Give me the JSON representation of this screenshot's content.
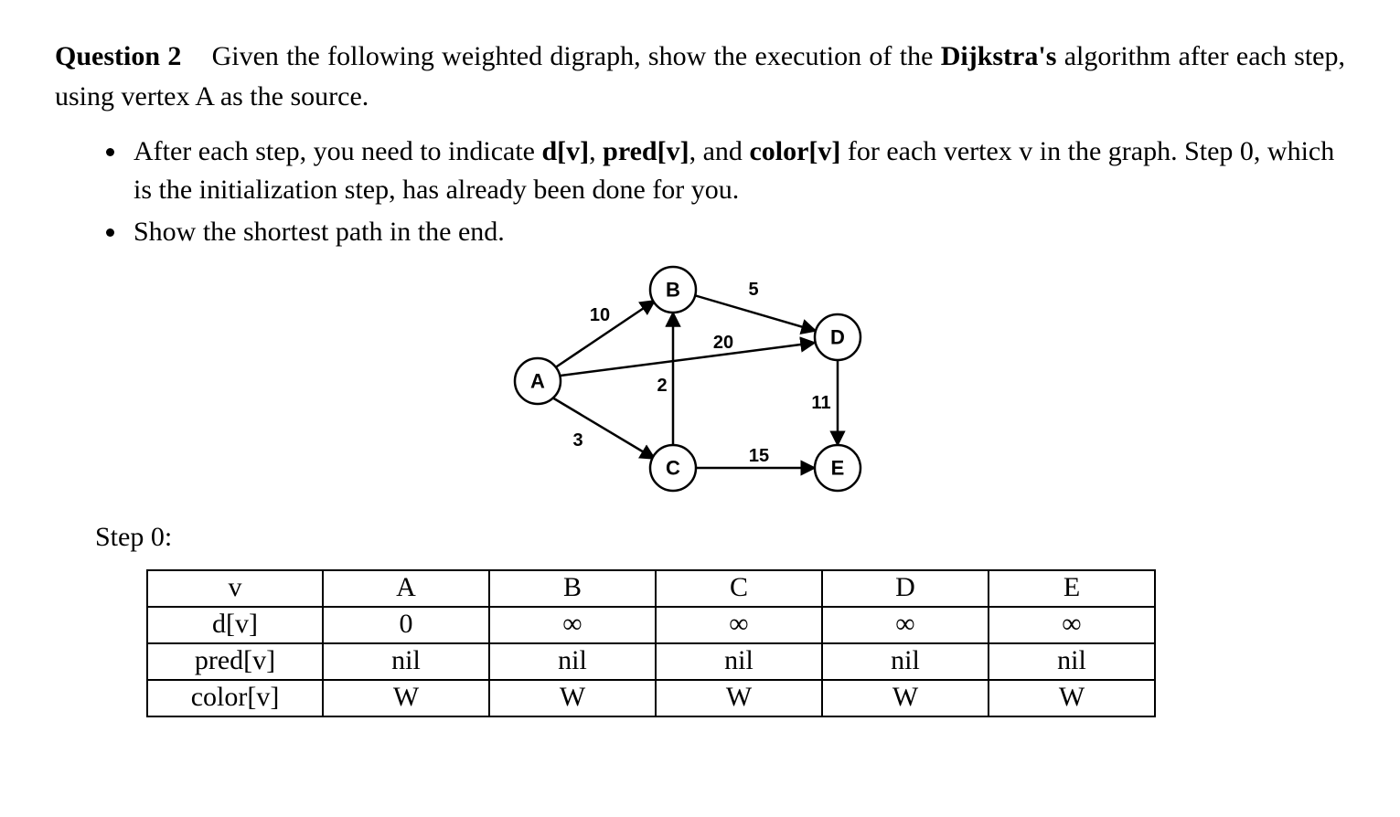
{
  "question": {
    "label": "Question 2",
    "prompt_before_alg": "Given the following weighted digraph, show the execution of the ",
    "algorithm_name": "Dijkstra's",
    "prompt_after_alg": " algorithm after each step, using vertex A as the source."
  },
  "bullets": {
    "b1_part1": "After each step, you need to indicate ",
    "b1_dv": "d[v]",
    "b1_sep1": ", ",
    "b1_pred": "pred[v]",
    "b1_sep2": ", and ",
    "b1_color": "color[v]",
    "b1_part2": " for each vertex v in the graph. Step 0, which is the initialization step, has already been done for you.",
    "b2": "Show the shortest path in the end."
  },
  "graph": {
    "nodes": {
      "A": "A",
      "B": "B",
      "C": "C",
      "D": "D",
      "E": "E"
    },
    "edges": {
      "AB": "10",
      "AD": "20",
      "AC": "3",
      "CB": "2",
      "BD": "5",
      "CE": "15",
      "DE": "11"
    }
  },
  "step0": {
    "label": "Step 0:",
    "headers": {
      "v": "v",
      "d": "d[v]",
      "pred": "pred[v]",
      "color": "color[v]"
    },
    "cols": [
      "A",
      "B",
      "C",
      "D",
      "E"
    ],
    "d": [
      "0",
      "∞",
      "∞",
      "∞",
      "∞"
    ],
    "pred": [
      "nil",
      "nil",
      "nil",
      "nil",
      "nil"
    ],
    "color": [
      "W",
      "W",
      "W",
      "W",
      "W"
    ]
  }
}
